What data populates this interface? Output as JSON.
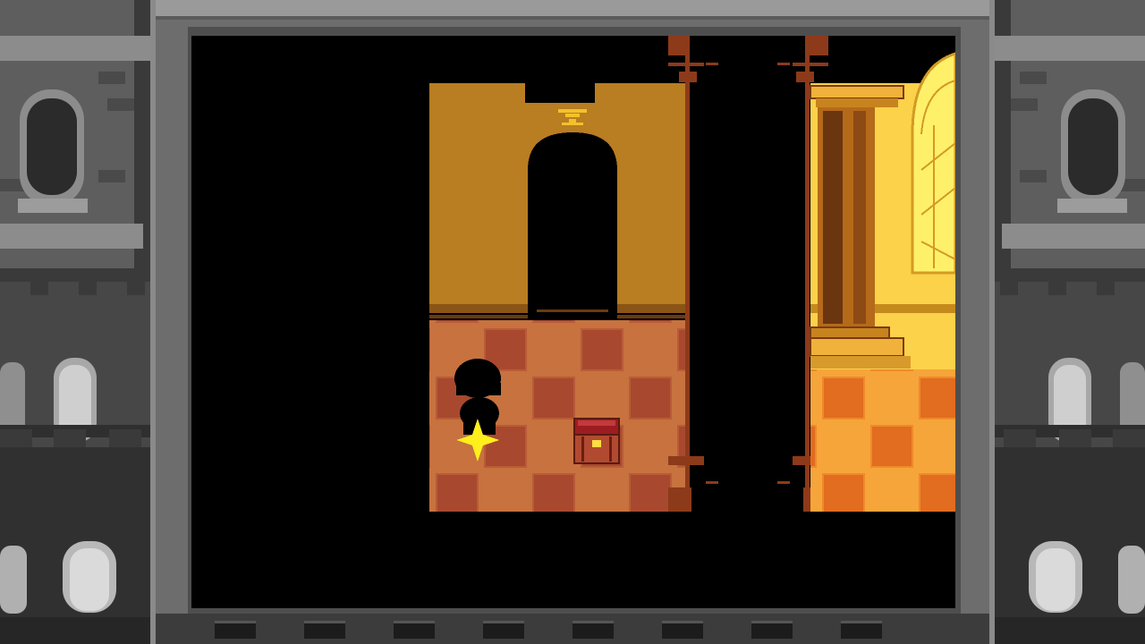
{
  "scene": {
    "location": "hallway-with-stained-glass",
    "player": {
      "sprite": "silhouette-character"
    },
    "objects": [
      {
        "kind": "treasure-chest",
        "state": "closed"
      },
      {
        "kind": "save-point-star"
      },
      {
        "kind": "arched-doorway"
      },
      {
        "kind": "delta-rune-emblem"
      },
      {
        "kind": "stained-glass-window"
      }
    ]
  },
  "colors": {
    "wall": "#b97d22",
    "wall_trim": "#8a5416",
    "floor_light": "#c7723f",
    "floor_dark": "#a8492f",
    "lit_floor_light": "#f6a53a",
    "lit_floor_dark": "#e26c20",
    "pillar_outline": "#8d3a1a",
    "window_glow": "#fbd24a",
    "save_star": "#ffef1d",
    "chest_body": "#b24a30",
    "chest_lid": "#9b1d22"
  }
}
